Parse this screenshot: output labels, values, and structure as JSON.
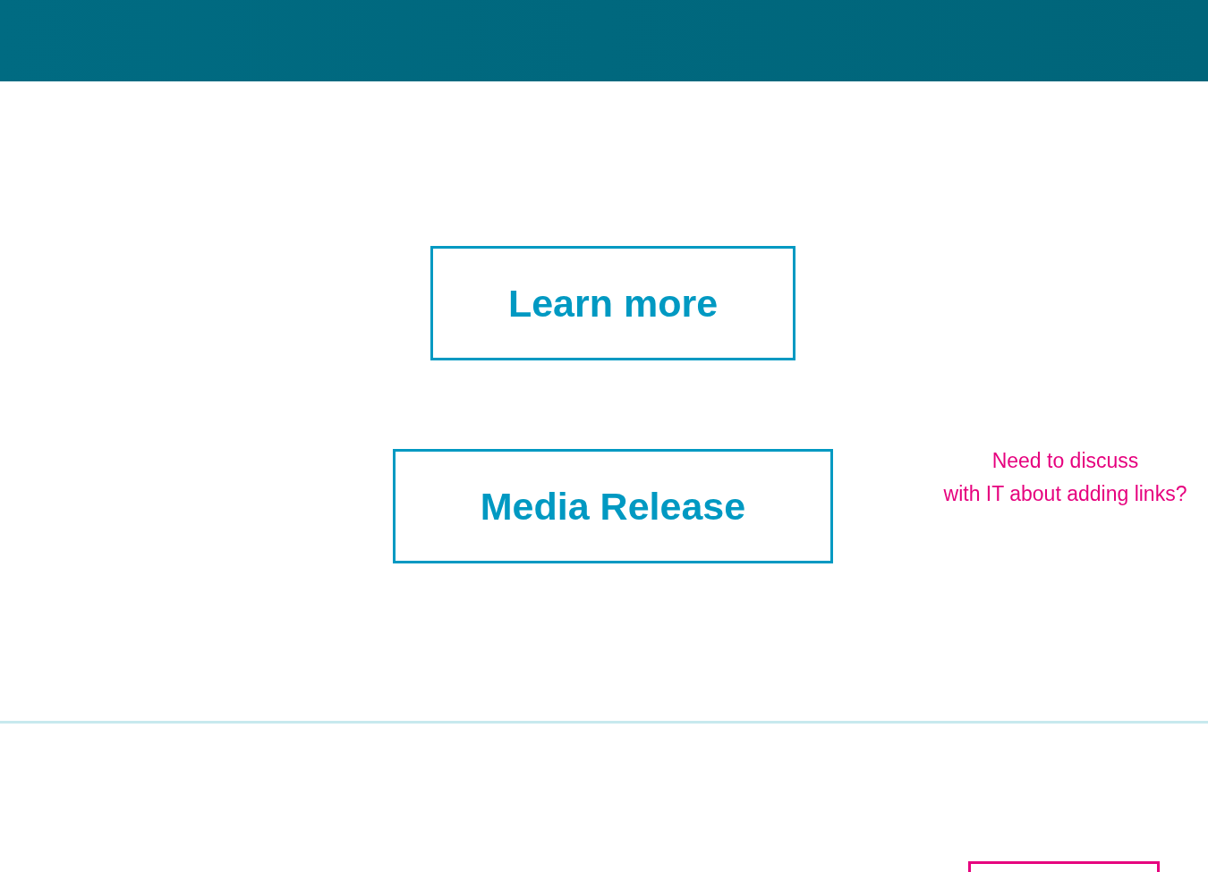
{
  "buttons": [
    {
      "label": "Learn more"
    },
    {
      "label": "Media Release"
    }
  ],
  "note": {
    "lines": [
      "Need to discuss",
      "with IT about adding links?"
    ]
  }
}
